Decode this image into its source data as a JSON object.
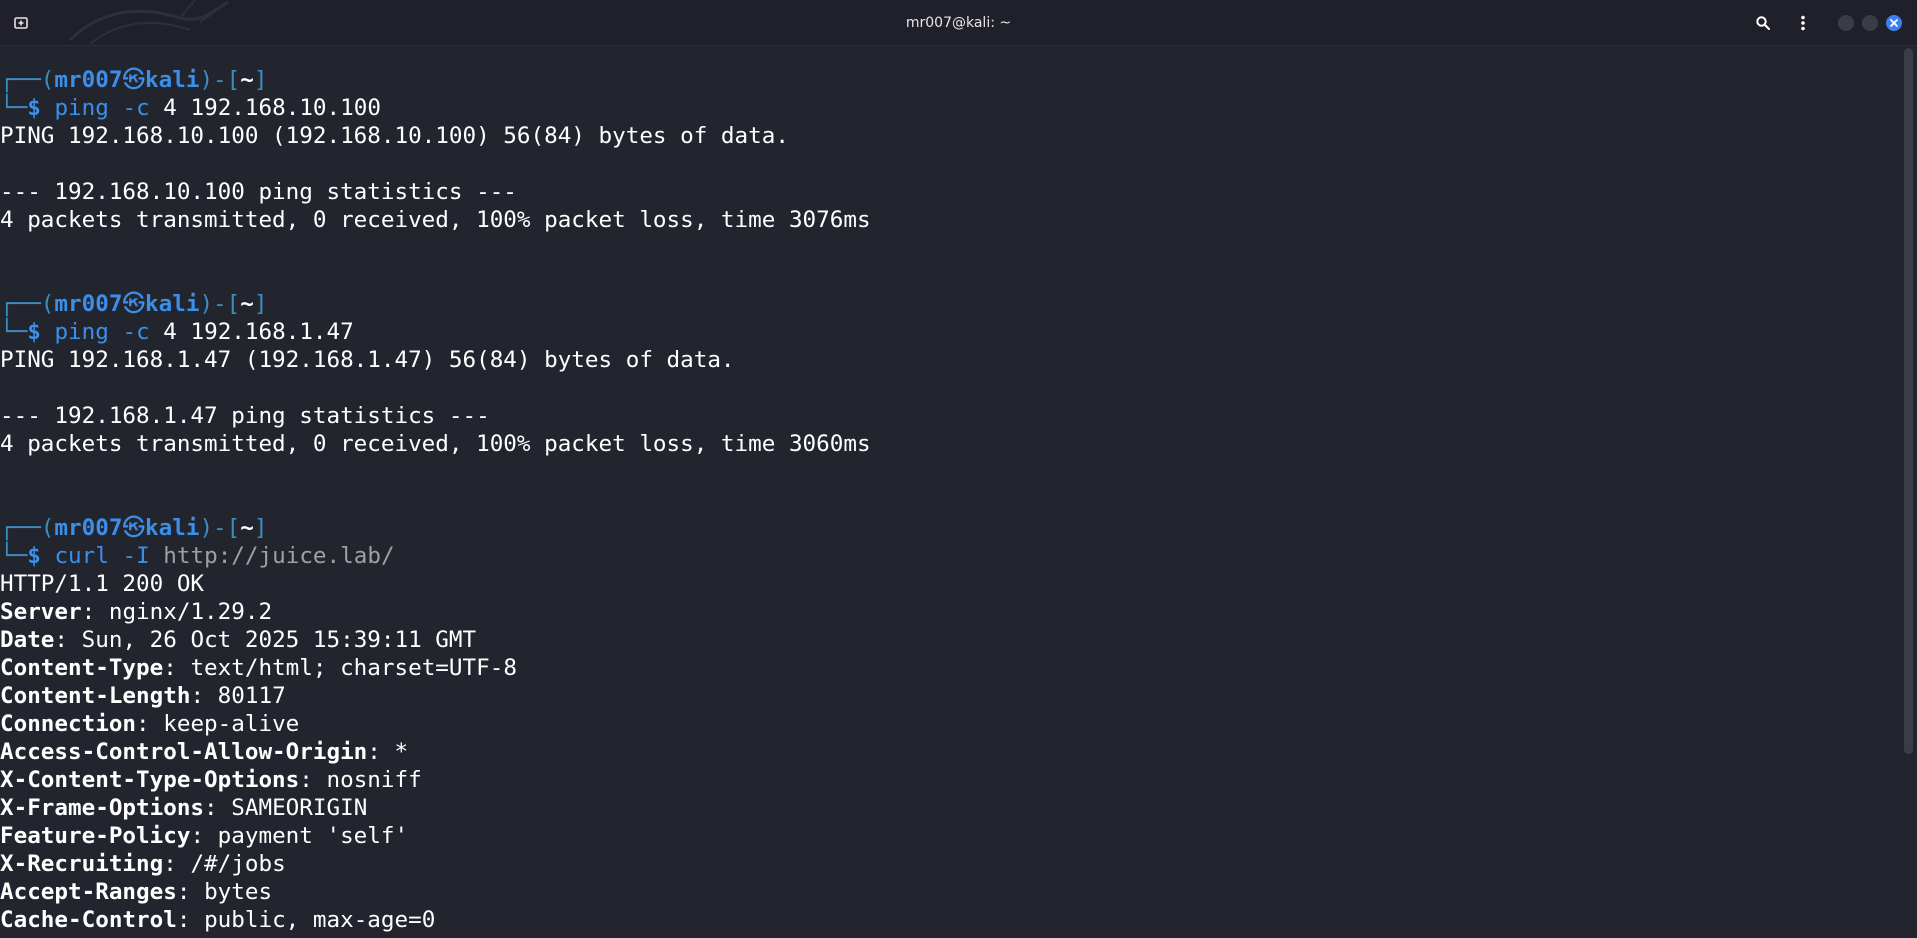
{
  "window": {
    "title": "mr007@kali: ~"
  },
  "icons": {
    "new_tab": "new-tab-icon",
    "search": "search-icon",
    "menu": "kebab-menu-icon",
    "close": "close-icon"
  },
  "colors": {
    "background": "#23252e",
    "titlebar": "#1f2029",
    "prompt_blue": "#3b8eea",
    "close_button": "#3d7ff0"
  },
  "prompt": {
    "prefix": "┌──(",
    "user": "mr007",
    "skull": "㉿",
    "host": "kali",
    "mid": ")-[",
    "dir": "~",
    "end": "]",
    "second_prefix": "└─",
    "sigil": "$"
  },
  "blocks": [
    {
      "command": "ping",
      "args": "-c",
      "rest": " 4 192.168.10.100",
      "output": [
        "PING 192.168.10.100 (192.168.10.100) 56(84) bytes of data.",
        "",
        "--- 192.168.10.100 ping statistics ---",
        "4 packets transmitted, 0 received, 100% packet loss, time 3076ms"
      ]
    },
    {
      "command": "ping",
      "args": "-c",
      "rest": " 4 192.168.1.47",
      "output": [
        "PING 192.168.1.47 (192.168.1.47) 56(84) bytes of data.",
        "",
        "--- 192.168.1.47 ping statistics ---",
        "4 packets transmitted, 0 received, 100% packet loss, time 3060ms"
      ]
    },
    {
      "command": "curl",
      "args": "-I",
      "url": "http://juice.lab/",
      "status_line": "HTTP/1.1 200 OK",
      "headers": [
        {
          "name": "Server",
          "value": "nginx/1.29.2"
        },
        {
          "name": "Date",
          "value": "Sun, 26 Oct 2025 15:39:11 GMT"
        },
        {
          "name": "Content-Type",
          "value": "text/html; charset=UTF-8"
        },
        {
          "name": "Content-Length",
          "value": "80117"
        },
        {
          "name": "Connection",
          "value": "keep-alive"
        },
        {
          "name": "Access-Control-Allow-Origin",
          "value": "*"
        },
        {
          "name": "X-Content-Type-Options",
          "value": "nosniff"
        },
        {
          "name": "X-Frame-Options",
          "value": "SAMEORIGIN"
        },
        {
          "name": "Feature-Policy",
          "value": "payment 'self'"
        },
        {
          "name": "X-Recruiting",
          "value": "/#/jobs"
        },
        {
          "name": "Accept-Ranges",
          "value": "bytes"
        },
        {
          "name": "Cache-Control",
          "value": "public, max-age=0"
        }
      ]
    }
  ]
}
